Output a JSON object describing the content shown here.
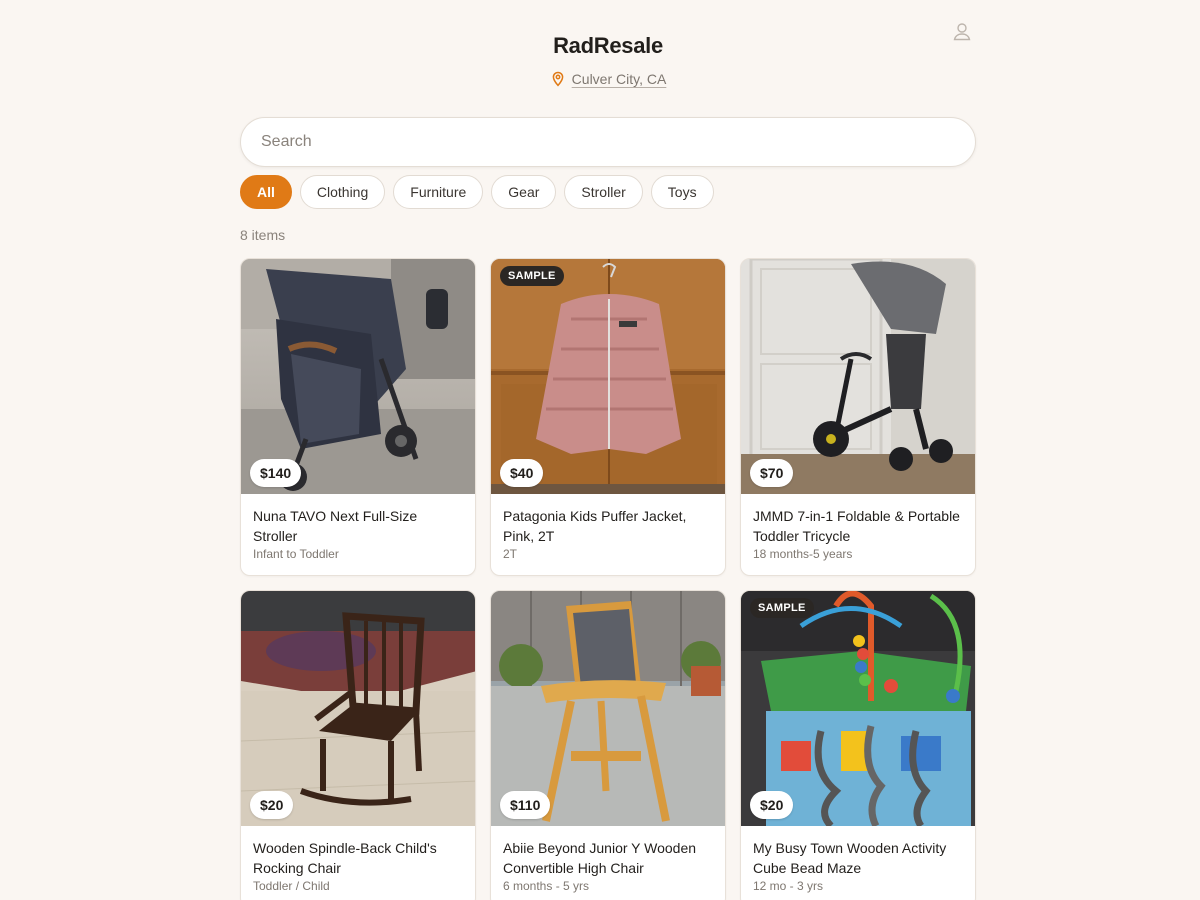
{
  "header": {
    "brand": "RadResale",
    "location": "Culver City, CA",
    "pin_icon": "map-pin-icon",
    "user_icon": "user-icon"
  },
  "search": {
    "placeholder": "Search",
    "value": ""
  },
  "filters": [
    {
      "label": "All",
      "active": true
    },
    {
      "label": "Clothing",
      "active": false
    },
    {
      "label": "Furniture",
      "active": false
    },
    {
      "label": "Gear",
      "active": false
    },
    {
      "label": "Stroller",
      "active": false
    },
    {
      "label": "Toys",
      "active": false
    }
  ],
  "results": {
    "count_label": "8 items"
  },
  "listings": [
    {
      "price": "$140",
      "title": "Nuna TAVO Next Full-Size Stroller",
      "subtitle": "Infant to Toddler",
      "badge": ""
    },
    {
      "price": "$40",
      "title": "Patagonia Kids Puffer Jacket, Pink, 2T",
      "subtitle": "2T",
      "badge": "SAMPLE"
    },
    {
      "price": "$70",
      "title": "JMMD 7-in-1 Foldable & Portable Toddler Tricycle",
      "subtitle": "18 months-5 years",
      "badge": ""
    },
    {
      "price": "$20",
      "title": "Wooden Spindle-Back Child's Rocking Chair",
      "subtitle": "Toddler / Child",
      "badge": ""
    },
    {
      "price": "$110",
      "title": "Abiie Beyond Junior Y Wooden Convertible High Chair",
      "subtitle": "6 months - 5 yrs",
      "badge": ""
    },
    {
      "price": "$20",
      "title": "My Busy Town Wooden Activity Cube Bead Maze",
      "subtitle": "12 mo - 3 yrs",
      "badge": "SAMPLE"
    }
  ],
  "colors": {
    "accent": "#e07a16",
    "background": "#faf6f2",
    "badge_dark": "#2b2724"
  }
}
